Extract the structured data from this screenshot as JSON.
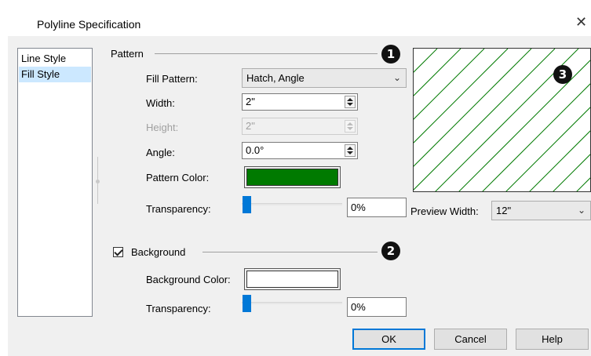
{
  "window": {
    "title": "Polyline Specification",
    "close_glyph": "✕"
  },
  "sidebar": {
    "items": [
      {
        "label": "Line Style",
        "selected": false
      },
      {
        "label": "Fill Style",
        "selected": true
      }
    ]
  },
  "pattern_group": {
    "label": "Pattern",
    "badge": "1",
    "fill_pattern": {
      "label": "Fill Pattern:",
      "value": "Hatch, Angle"
    },
    "width": {
      "label": "Width:",
      "value": "2\""
    },
    "height": {
      "label": "Height:",
      "value": "2\""
    },
    "angle": {
      "label": "Angle:",
      "value": "0.0°"
    },
    "pattern_color": {
      "label": "Pattern Color:",
      "color": "#007a00"
    },
    "transparency": {
      "label": "Transparency:",
      "value": "0%",
      "level": 0
    }
  },
  "background_group": {
    "label": "Background",
    "checked": true,
    "badge": "2",
    "background_color": {
      "label": "Background Color:",
      "color": "#ffffff"
    },
    "transparency": {
      "label": "Transparency:",
      "value": "0%",
      "level": 0
    }
  },
  "preview": {
    "badge": "3",
    "line_color": "#007a00",
    "width_label": "Preview Width:",
    "width_value": "12\""
  },
  "buttons": {
    "ok": "OK",
    "cancel": "Cancel",
    "help": "Help"
  },
  "colors": {
    "accent": "#0078d7",
    "selection": "#cce8ff"
  }
}
